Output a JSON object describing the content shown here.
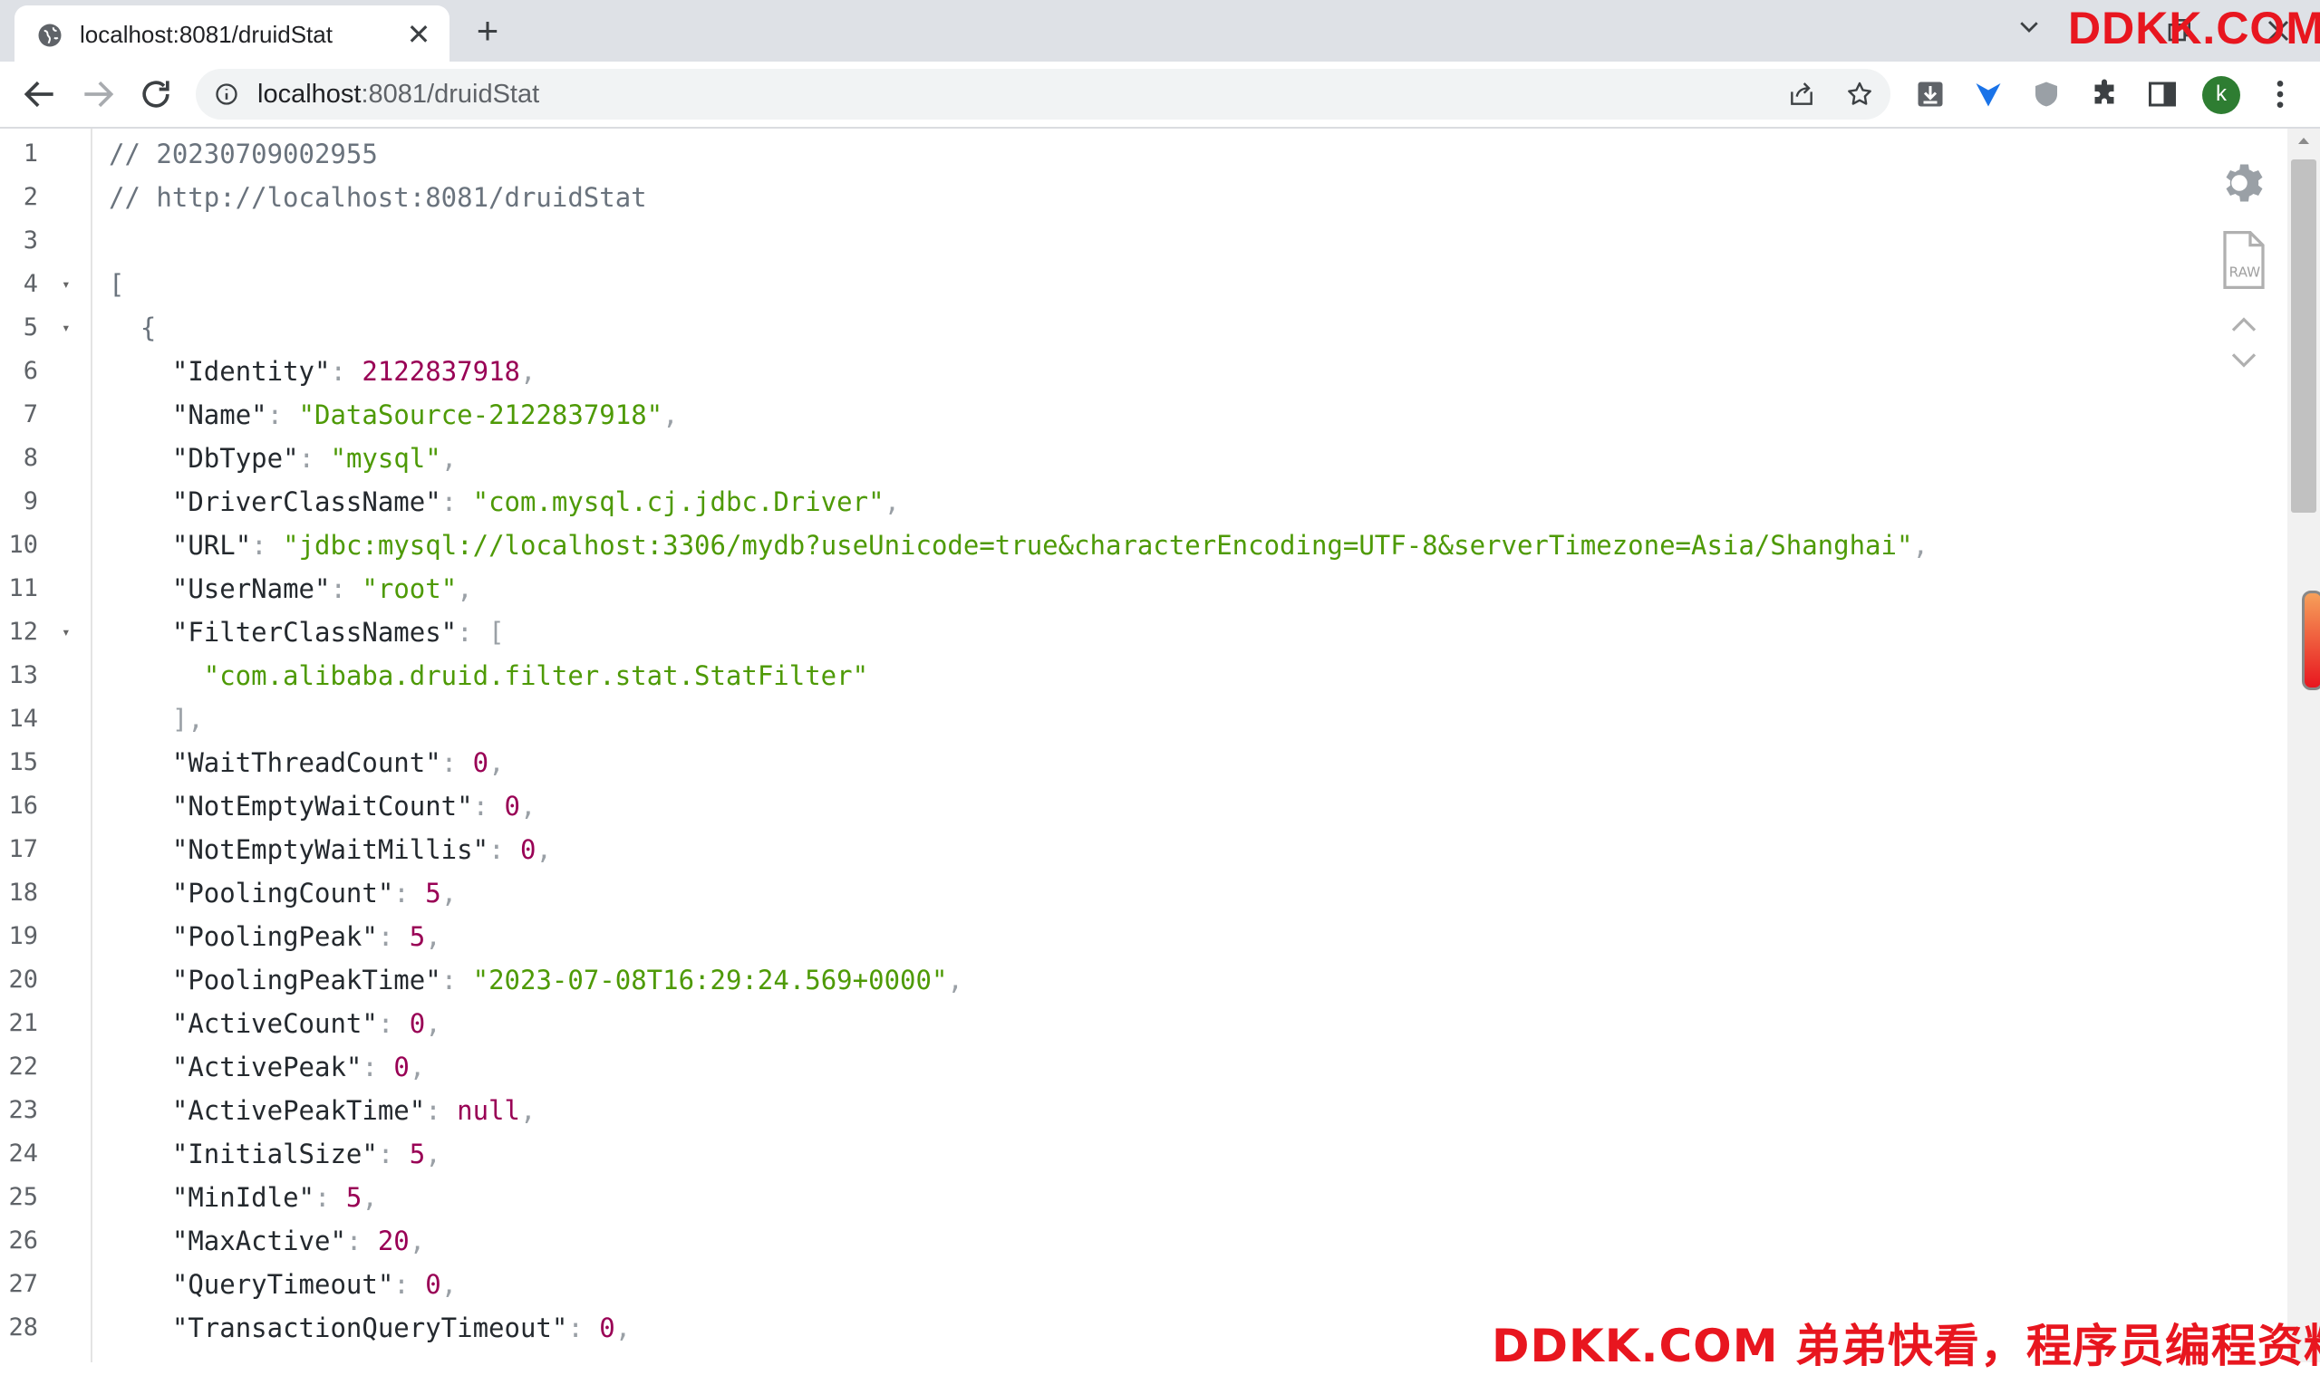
{
  "browser": {
    "tab": {
      "title": "localhost:8081/druidStat",
      "close_symbol": "✕"
    },
    "new_tab_symbol": "+",
    "address": {
      "host": "localhost",
      "path": ":8081/druidStat"
    },
    "profile_initial": "k",
    "watermark_top": "DDKK.COM",
    "icons": [
      "globe-icon",
      "chevron-down-icon",
      "back-arrow-icon",
      "forward-arrow-icon",
      "reload-icon",
      "info-icon",
      "share-icon",
      "star-icon",
      "download-icon",
      "extension-icon",
      "puzzle-icon",
      "sidepanel-icon",
      "kebab-menu-icon"
    ]
  },
  "viewer": {
    "lines": [
      {
        "n": "1",
        "fold": "",
        "code": "// 20230709002955"
      },
      {
        "n": "2",
        "fold": "",
        "code": "// http://localhost:8081/druidStat"
      },
      {
        "n": "3",
        "fold": "",
        "code": ""
      },
      {
        "n": "4",
        "fold": "▾",
        "code": "["
      },
      {
        "n": "5",
        "fold": "▾",
        "code": "  {"
      },
      {
        "n": "6",
        "fold": "",
        "key": "Identity",
        "num": "2122837918"
      },
      {
        "n": "7",
        "fold": "",
        "key": "Name",
        "str": "DataSource-2122837918"
      },
      {
        "n": "8",
        "fold": "",
        "key": "DbType",
        "str": "mysql"
      },
      {
        "n": "9",
        "fold": "",
        "key": "DriverClassName",
        "str": "com.mysql.cj.jdbc.Driver"
      },
      {
        "n": "10",
        "fold": "",
        "key": "URL",
        "str": "jdbc:mysql://localhost:3306/mydb?useUnicode=true&characterEncoding=UTF-8&serverTimezone=Asia/Shanghai"
      },
      {
        "n": "11",
        "fold": "",
        "key": "UserName",
        "str": "root"
      },
      {
        "n": "12",
        "fold": "▾",
        "key": "FilterClassNames",
        "open": "["
      },
      {
        "n": "13",
        "fold": "",
        "item": "com.alibaba.druid.filter.stat.StatFilter"
      },
      {
        "n": "14",
        "fold": "",
        "close": "],"
      },
      {
        "n": "15",
        "fold": "",
        "key": "WaitThreadCount",
        "num": "0"
      },
      {
        "n": "16",
        "fold": "",
        "key": "NotEmptyWaitCount",
        "num": "0"
      },
      {
        "n": "17",
        "fold": "",
        "key": "NotEmptyWaitMillis",
        "num": "0"
      },
      {
        "n": "18",
        "fold": "",
        "key": "PoolingCount",
        "num": "5"
      },
      {
        "n": "19",
        "fold": "",
        "key": "PoolingPeak",
        "num": "5"
      },
      {
        "n": "20",
        "fold": "",
        "key": "PoolingPeakTime",
        "str": "2023-07-08T16:29:24.569+0000"
      },
      {
        "n": "21",
        "fold": "",
        "key": "ActiveCount",
        "num": "0"
      },
      {
        "n": "22",
        "fold": "",
        "key": "ActivePeak",
        "num": "0"
      },
      {
        "n": "23",
        "fold": "",
        "key": "ActivePeakTime",
        "nul": "null"
      },
      {
        "n": "24",
        "fold": "",
        "key": "InitialSize",
        "num": "5"
      },
      {
        "n": "25",
        "fold": "",
        "key": "MinIdle",
        "num": "5"
      },
      {
        "n": "26",
        "fold": "",
        "key": "MaxActive",
        "num": "20"
      },
      {
        "n": "27",
        "fold": "",
        "key": "QueryTimeout",
        "num": "0"
      },
      {
        "n": "28",
        "fold": "",
        "key": "TransactionQueryTimeout",
        "num": "0"
      }
    ],
    "raw_label": "RAW"
  },
  "watermark_bottom": "DDKK.COM 弟弟快看，程序员编程资料站"
}
